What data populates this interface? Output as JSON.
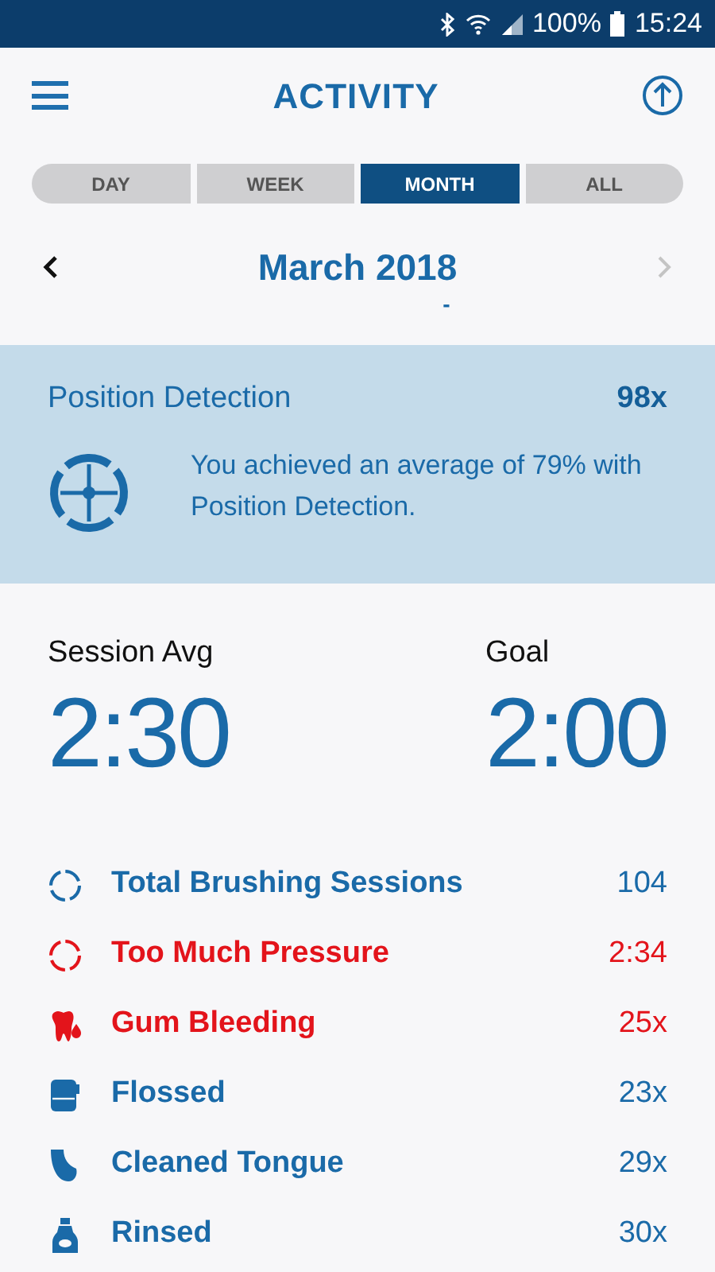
{
  "status_bar": {
    "battery": "100%",
    "time": "15:24"
  },
  "header": {
    "title": "ACTIVITY"
  },
  "tabs": [
    {
      "label": "DAY",
      "selected": false
    },
    {
      "label": "WEEK",
      "selected": false
    },
    {
      "label": "MONTH",
      "selected": true
    },
    {
      "label": "ALL",
      "selected": false
    }
  ],
  "period": {
    "label": "March 2018",
    "marker": "-",
    "next_disabled": true
  },
  "position_card": {
    "title": "Position Detection",
    "count": "98x",
    "message": "You achieved an average of 79% with Position Detection."
  },
  "session_avg": {
    "label": "Session Avg",
    "value": "2:30"
  },
  "goal": {
    "label": "Goal",
    "value": "2:00"
  },
  "stats": [
    {
      "kind": "sessions",
      "label": "Total Brushing Sessions",
      "value": "104",
      "alert": false
    },
    {
      "kind": "pressure",
      "label": "Too Much Pressure",
      "value": "2:34",
      "alert": true
    },
    {
      "kind": "bleeding",
      "label": "Gum Bleeding",
      "value": "25x",
      "alert": true
    },
    {
      "kind": "floss",
      "label": "Flossed",
      "value": "23x",
      "alert": false
    },
    {
      "kind": "tongue",
      "label": "Cleaned Tongue",
      "value": "29x",
      "alert": false
    },
    {
      "kind": "rinse",
      "label": "Rinsed",
      "value": "30x",
      "alert": false
    }
  ]
}
